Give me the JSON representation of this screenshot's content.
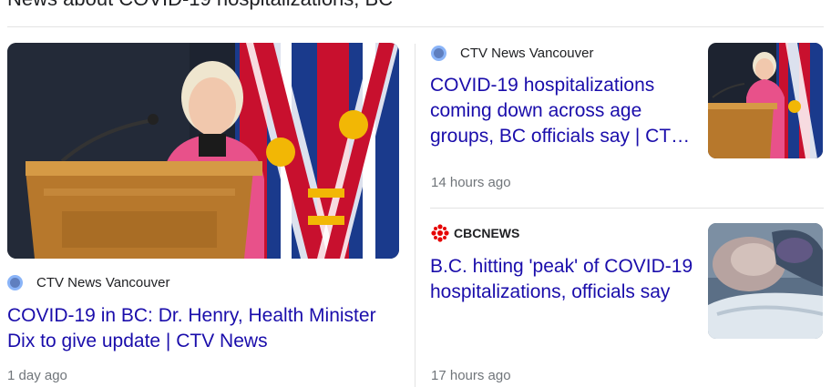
{
  "section": {
    "title": "News about COVID-19 hospitalizations, BC"
  },
  "articles": [
    {
      "source": "CTV News Vancouver",
      "source_icon": "globe-icon",
      "headline": "COVID-19 in BC: Dr. Henry, Health Minister Dix to give update | CTV News",
      "time": "1 day ago"
    },
    {
      "source": "CTV News Vancouver",
      "source_icon": "globe-icon",
      "headline": "COVID-19 hospitalizations coming down across age groups, BC officials say | CT…",
      "time": "14 hours ago"
    },
    {
      "source": "CBCNEWS",
      "source_icon": "cbc-gem-icon",
      "headline": "B.C. hitting 'peak' of COVID-19 hospitalizations, officials say",
      "time": "17 hours ago"
    }
  ],
  "colors": {
    "link": "#1a0dab",
    "meta": "#70757a",
    "cbc_red": "#e60505"
  }
}
